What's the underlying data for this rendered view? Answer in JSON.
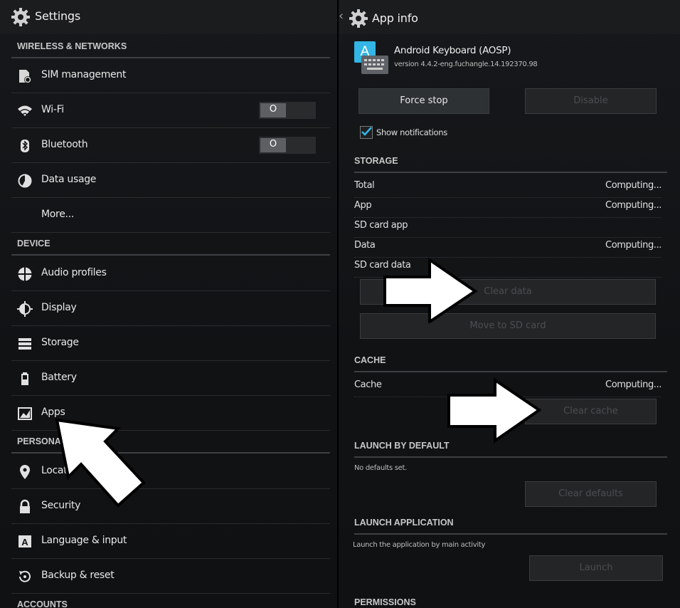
{
  "settings": {
    "title": "Settings",
    "sections": {
      "wireless": "WIRELESS & NETWORKS",
      "device": "DEVICE",
      "personal": "PERSONA",
      "accounts": "ACCOUNTS"
    },
    "items": {
      "sim": "SIM management",
      "wifi": "Wi-Fi",
      "bluetooth": "Bluetooth",
      "data_usage": "Data usage",
      "more": "More...",
      "audio": "Audio profiles",
      "display": "Display",
      "storage": "Storage",
      "battery": "Battery",
      "apps": "Apps",
      "location": "Locat",
      "security": "Security",
      "language": "Language & input",
      "backup": "Backup & reset"
    },
    "toggles": {
      "wifi_state": "O",
      "bluetooth_state": "O"
    }
  },
  "app_info": {
    "back_glyph": "‹",
    "title": "App info",
    "app_name": "Android Keyboard (AOSP)",
    "app_version": "version 4.4.2-eng.fuchangle.14.192370.98",
    "app_icon_letter": "A",
    "force_stop": "Force stop",
    "disable": "Disable",
    "show_notifications": "Show notifications",
    "storage_header": "STORAGE",
    "storage_rows": [
      {
        "label": "Total",
        "value": "Computing..."
      },
      {
        "label": "App",
        "value": "Computing..."
      },
      {
        "label": "SD card app",
        "value": ""
      },
      {
        "label": "Data",
        "value": "Computing..."
      },
      {
        "label": "SD card data",
        "value": ""
      }
    ],
    "clear_data": "Clear data",
    "move_to_sd": "Move to SD card",
    "cache_header": "CACHE",
    "cache_label": "Cache",
    "cache_value": "Computing...",
    "clear_cache": "Clear cache",
    "launch_default_header": "LAUNCH BY DEFAULT",
    "no_defaults": "No defaults set.",
    "clear_defaults": "Clear defaults",
    "launch_app_header": "LAUNCH APPLICATION",
    "launch_desc": "Launch the application by main activity",
    "launch": "Launch",
    "permissions_header": "PERMISSIONS"
  },
  "colors": {
    "accent": "#33b5e5",
    "bg": "#111315",
    "text": "#e6e6e6"
  }
}
